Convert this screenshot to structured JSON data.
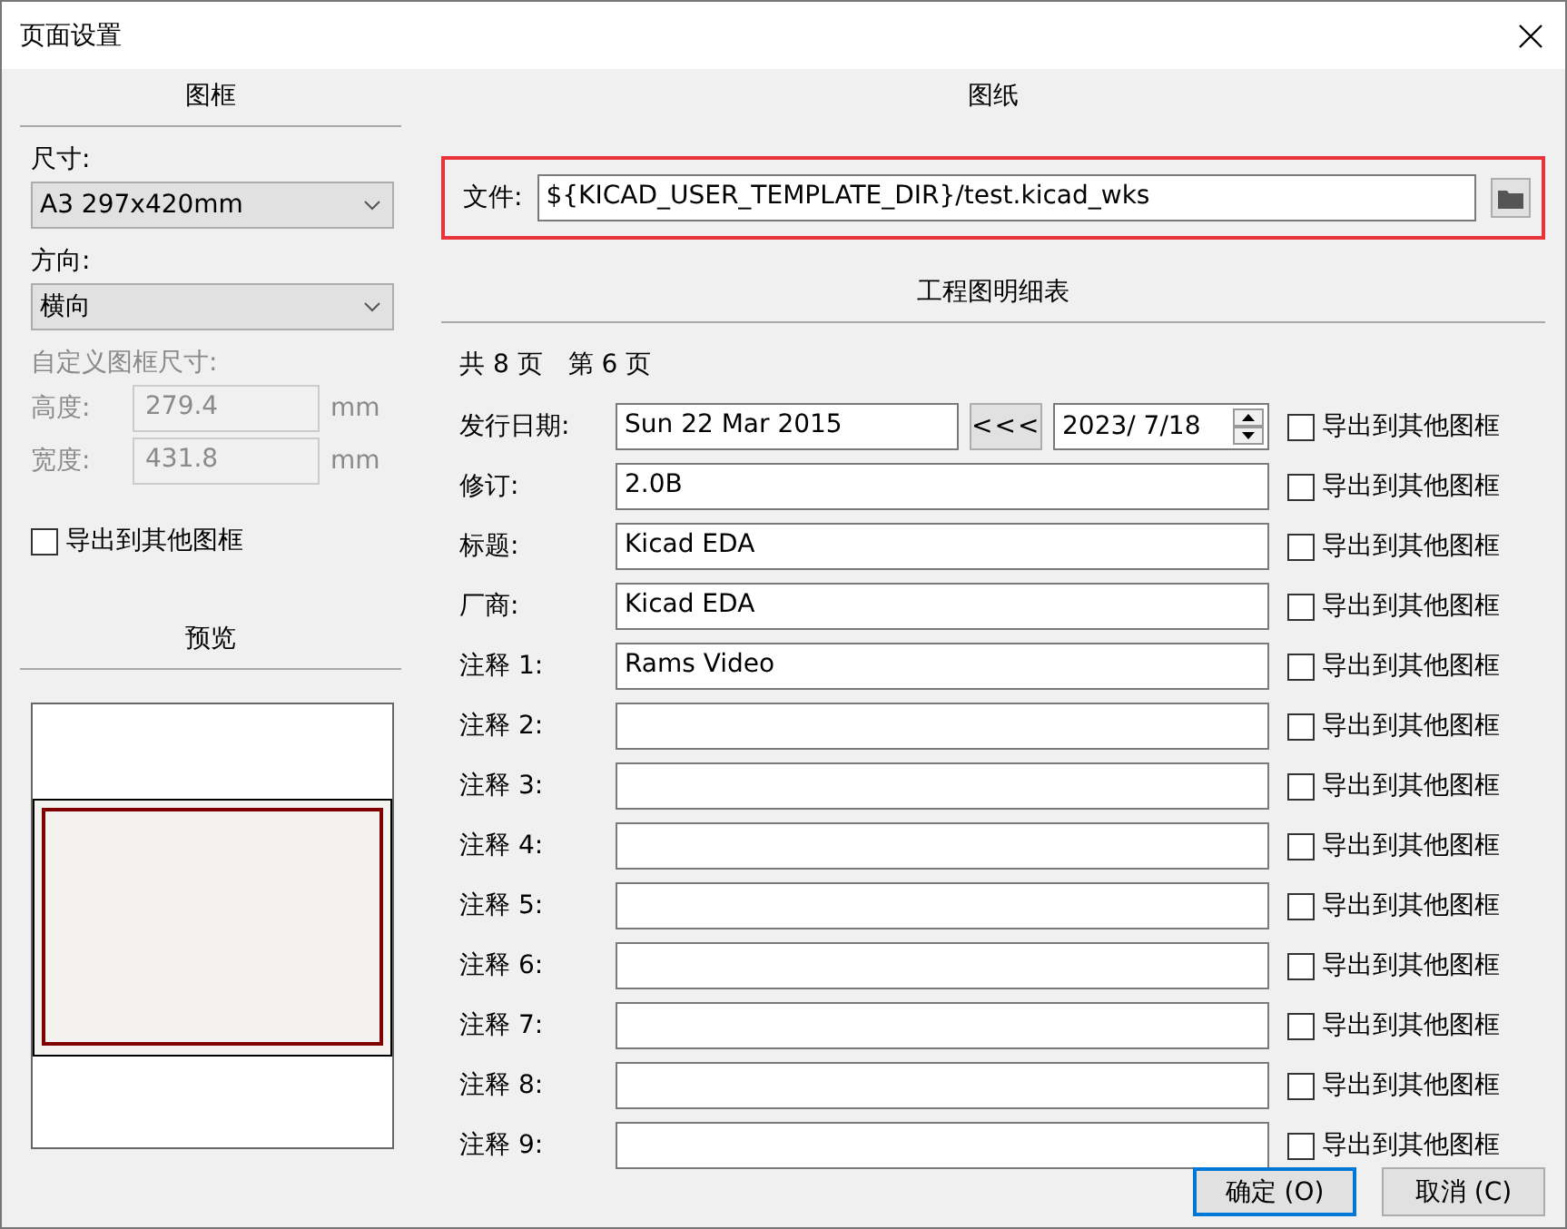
{
  "window": {
    "title": "页面设置"
  },
  "frame": {
    "heading": "图框",
    "size": {
      "label": "尺寸:",
      "value": "A3 297x420mm"
    },
    "orientation": {
      "label": "方向:",
      "value": "横向"
    },
    "custom": {
      "label": "自定义图框尺寸:",
      "disabled": true,
      "fields": [
        {
          "label": "高度:",
          "value": "279.4",
          "unit": "mm"
        },
        {
          "label": "宽度:",
          "value": "431.8",
          "unit": "mm"
        }
      ]
    },
    "export": {
      "label": "导出到其他图框",
      "checked": false
    }
  },
  "preview": {
    "heading": "预览"
  },
  "sheet": {
    "heading": "图纸",
    "file": {
      "label": "文件:",
      "value": "${KICAD_USER_TEMPLATE_DIR}/test.kicad_wks",
      "highlighted": true
    }
  },
  "title_block": {
    "heading": "工程图明细表",
    "page_count": "共 8 页",
    "page_number": "第 6 页",
    "fields": [
      {
        "kind": "date",
        "label": "发行日期:",
        "value": "Sun 22 Mar 2015",
        "button": "<<<",
        "date_value": "2023/  7/18",
        "export": {
          "label": "导出到其他图框",
          "checked": false
        }
      },
      {
        "kind": "text",
        "label": "修订:",
        "value": "2.0B",
        "export": {
          "label": "导出到其他图框",
          "checked": false
        }
      },
      {
        "kind": "text",
        "label": "标题:",
        "value": "Kicad EDA",
        "export": {
          "label": "导出到其他图框",
          "checked": false
        }
      },
      {
        "kind": "text",
        "label": "厂商:",
        "value": "Kicad EDA",
        "export": {
          "label": "导出到其他图框",
          "checked": false
        }
      },
      {
        "kind": "text",
        "label": "注释 1:",
        "value": "Rams Video",
        "export": {
          "label": "导出到其他图框",
          "checked": false
        }
      },
      {
        "kind": "text",
        "label": "注释 2:",
        "export": {
          "label": "导出到其他图框",
          "checked": false
        }
      },
      {
        "kind": "text",
        "label": "注释 3:",
        "export": {
          "label": "导出到其他图框",
          "checked": false
        }
      },
      {
        "kind": "text",
        "label": "注释 4:",
        "export": {
          "label": "导出到其他图框",
          "checked": false
        }
      },
      {
        "kind": "text",
        "label": "注释 5:",
        "export": {
          "label": "导出到其他图框",
          "checked": false
        }
      },
      {
        "kind": "text",
        "label": "注释 6:",
        "export": {
          "label": "导出到其他图框",
          "checked": false
        }
      },
      {
        "kind": "text",
        "label": "注释 7:",
        "export": {
          "label": "导出到其他图框",
          "checked": false
        }
      },
      {
        "kind": "text",
        "label": "注释 8:",
        "export": {
          "label": "导出到其他图框",
          "checked": false
        }
      },
      {
        "kind": "text",
        "label": "注释 9:",
        "export": {
          "label": "导出到其他图框",
          "checked": false
        }
      }
    ]
  },
  "buttons": [
    {
      "label": "确定 (O)",
      "default": true
    },
    {
      "label": "取消 (C)",
      "default": false
    }
  ]
}
